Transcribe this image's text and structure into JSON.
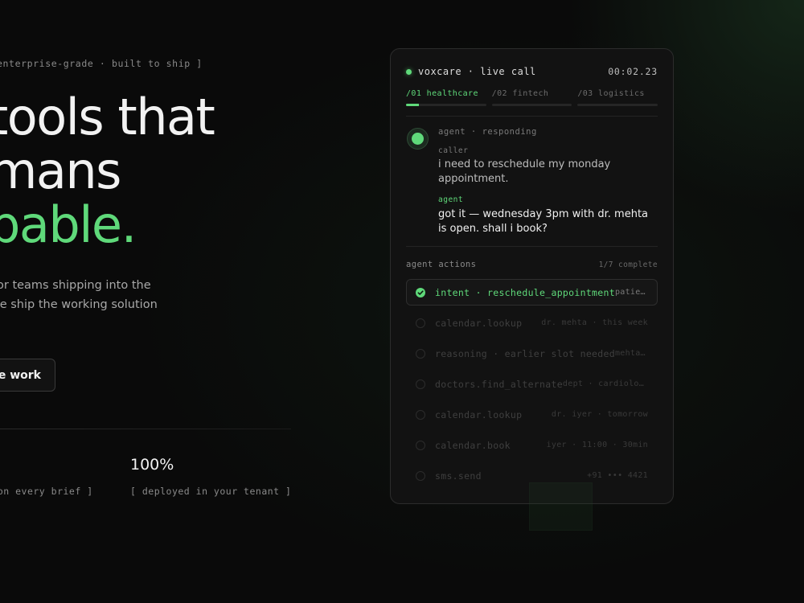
{
  "hero": {
    "eyebrow": "enterprise-grade · built to ship ]",
    "headline_line1": "tools that",
    "headline_line2": "mans",
    "headline_line3": "pable.",
    "subcopy_line1": "tems for teams shipping into the",
    "subcopy_line2": "m — we ship the working solution",
    "cta_label": "ve work",
    "stats": [
      {
        "value": "",
        "label": "y on every brief ]"
      },
      {
        "value": "100%",
        "label": "[ deployed in your tenant ]"
      }
    ]
  },
  "panel": {
    "title": "voxcare · live call",
    "timer": "00:02.23",
    "tabs": [
      {
        "label": "/01 healthcare",
        "active": true,
        "progress": 0.16
      },
      {
        "label": "/02 fintech",
        "active": false,
        "progress": 0
      },
      {
        "label": "/03 logistics",
        "active": false,
        "progress": 0
      }
    ],
    "agent_status": "agent · responding",
    "messages": [
      {
        "role": "caller",
        "text": "i need to reschedule my monday appointment."
      },
      {
        "role": "agent",
        "text": "got it — wednesday 3pm with dr. mehta is open. shall i book?"
      }
    ],
    "actions_title": "agent actions",
    "actions_count": "1/7 complete",
    "actions": [
      {
        "name": "intent · reschedule_appointment",
        "detail": "patient…",
        "status": "done"
      },
      {
        "name": "calendar.lookup",
        "detail": "dr. mehta · this week",
        "status": "pending"
      },
      {
        "name": "reasoning · earlier slot needed",
        "detail": "mehta f…",
        "status": "pending"
      },
      {
        "name": "doctors.find_alternate",
        "detail": "dept · cardiology",
        "status": "pending"
      },
      {
        "name": "calendar.lookup",
        "detail": "dr. iyer · tomorrow",
        "status": "pending"
      },
      {
        "name": "calendar.book",
        "detail": "iyer · 11:00 · 30min",
        "status": "pending"
      },
      {
        "name": "sms.send",
        "detail": "+91 ••• 4421",
        "status": "pending"
      }
    ]
  },
  "colors": {
    "accent": "#5fd97a",
    "background": "#0a0a0a",
    "panel": "#121212"
  },
  "icons": {
    "live": "live-dot-icon",
    "done": "check-circle-icon",
    "pending": "empty-circle-icon"
  }
}
